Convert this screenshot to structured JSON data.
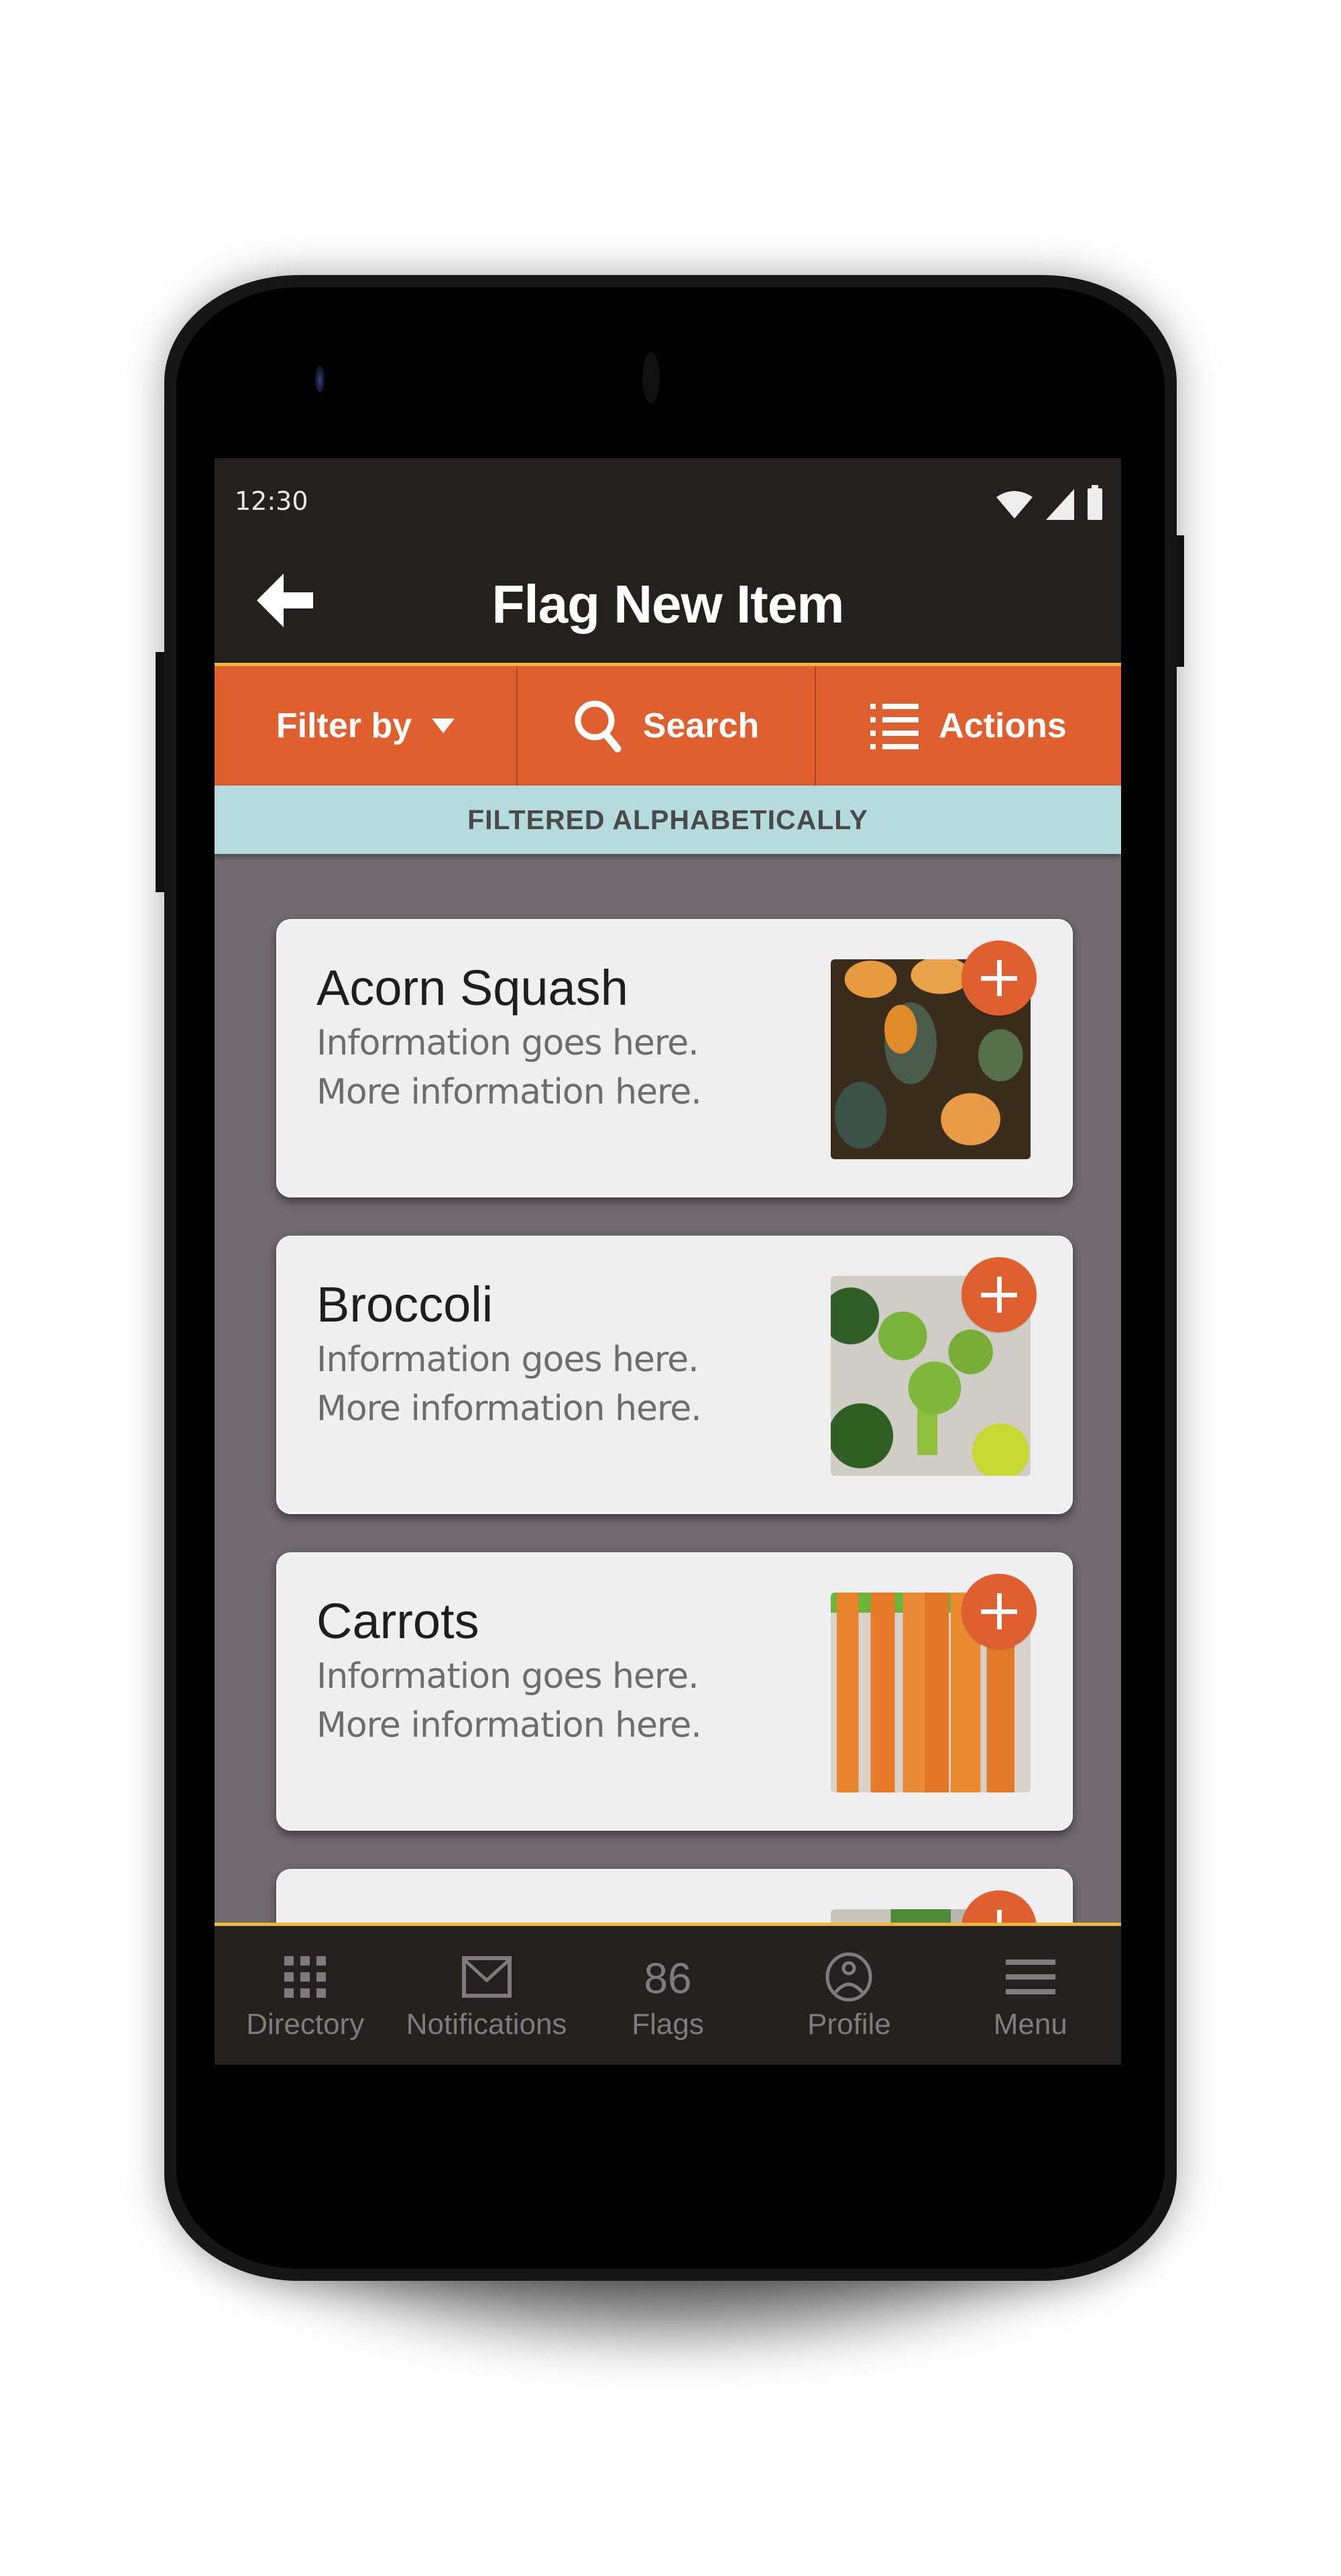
{
  "status_bar": {
    "time": "12:30",
    "icons": [
      "wifi-icon",
      "cellular-signal-icon",
      "battery-icon"
    ]
  },
  "app_bar": {
    "back_icon": "arrow-left-icon",
    "title": "Flag New Item"
  },
  "toolbar": {
    "filter": {
      "label": "Filter by",
      "icon": "caret-down-icon"
    },
    "search": {
      "label": "Search",
      "icon": "search-icon"
    },
    "actions": {
      "label": "Actions",
      "icon": "list-icon"
    }
  },
  "banner": {
    "text": "FILTERED ALPHABETICALLY"
  },
  "items": [
    {
      "title": "Acorn Squash",
      "line1": "Information goes here.",
      "line2": "More information here.",
      "image": "acorn squash photo",
      "action_icon": "plus-icon"
    },
    {
      "title": "Broccoli",
      "line1": "Information goes here.",
      "line2": "More information here.",
      "image": "broccoli photo",
      "action_icon": "plus-icon"
    },
    {
      "title": "Carrots",
      "line1": "Information goes here.",
      "line2": "More information here.",
      "image": "carrots photo",
      "action_icon": "plus-icon"
    },
    {
      "title": "",
      "line1": "",
      "line2": "",
      "image": "partially visible photo",
      "action_icon": "plus-icon"
    }
  ],
  "bottom_nav": {
    "items": [
      {
        "label": "Directory",
        "icon": "grid-icon"
      },
      {
        "label": "Notifications",
        "icon": "envelope-icon"
      },
      {
        "label": "Flags",
        "count": "86"
      },
      {
        "label": "Profile",
        "icon": "user-circle-icon"
      },
      {
        "label": "Menu",
        "icon": "hamburger-menu-icon"
      }
    ]
  },
  "colors": {
    "accent_orange": "#df5f2f",
    "gold_divider": "#f1b73a",
    "banner_bg": "#b6dbdd",
    "content_bg": "#716a6f",
    "bar_bg": "#222120",
    "card_bg": "#efefef",
    "nav_text": "#807a7e"
  }
}
